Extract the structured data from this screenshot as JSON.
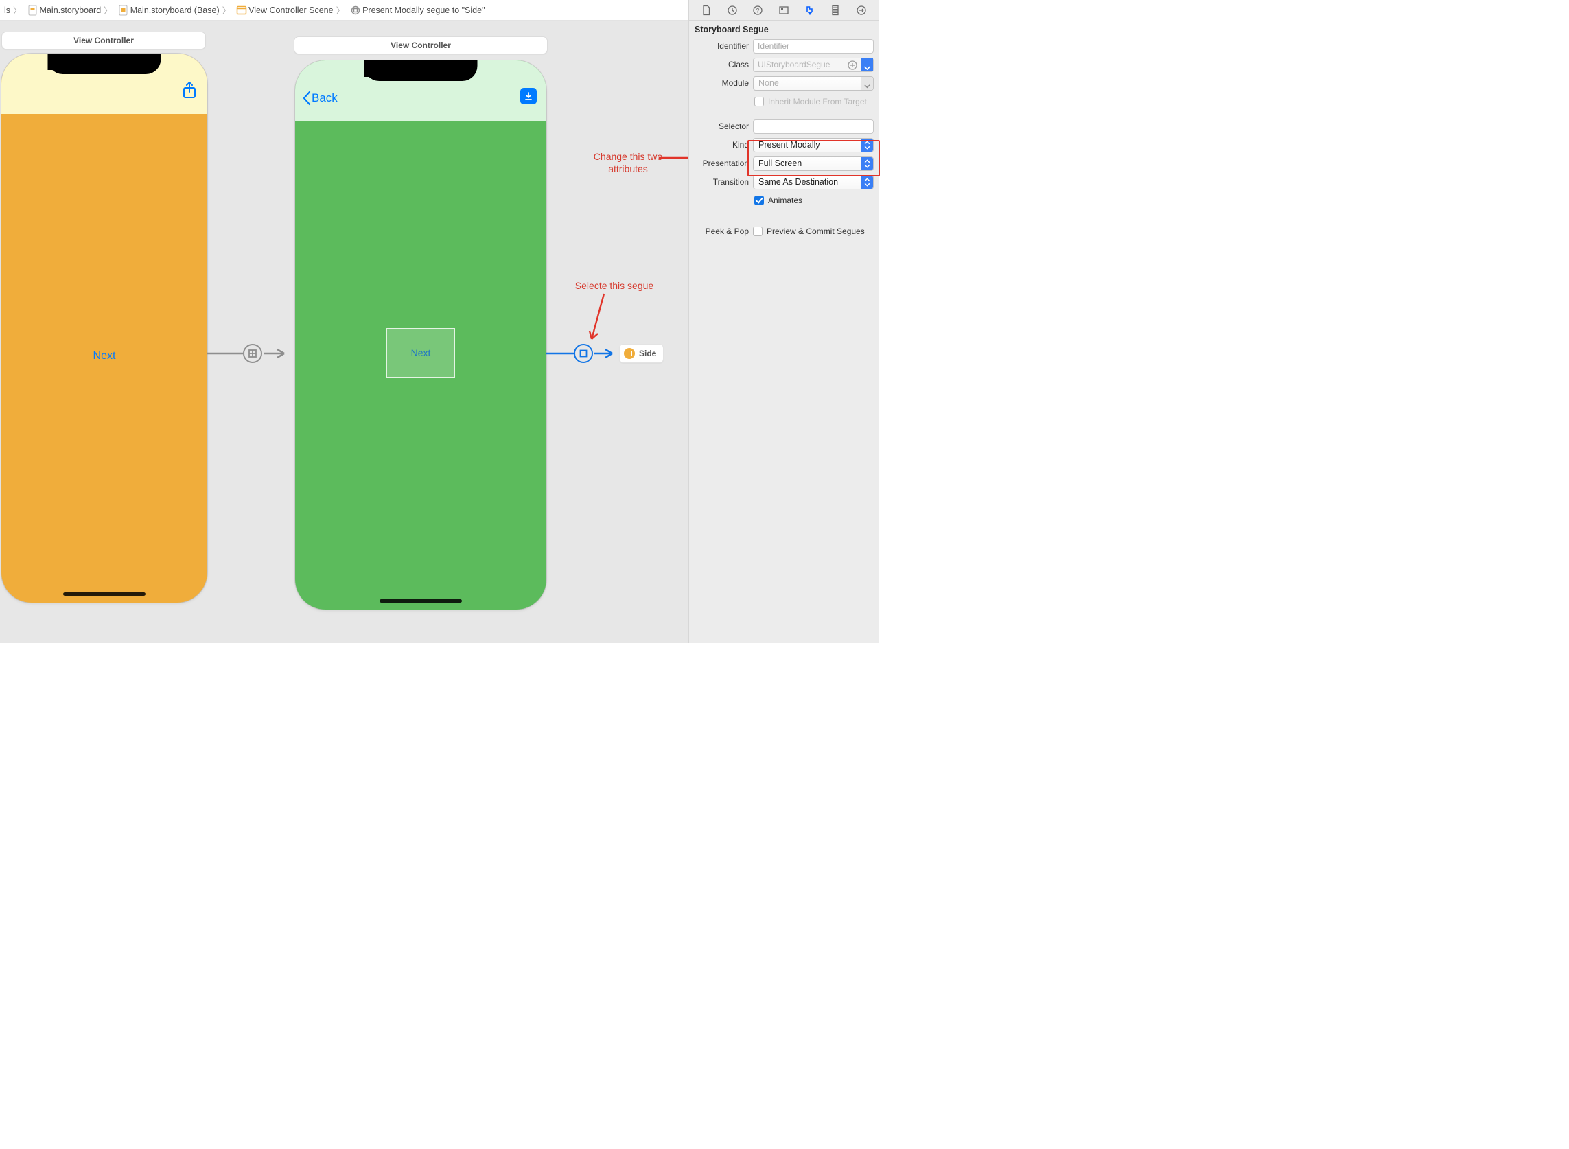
{
  "breadcrumbs": {
    "item0": "ls",
    "item1": "Main.storyboard",
    "item2": "Main.storyboard (Base)",
    "item3": "View Controller Scene",
    "item4": "Present Modally segue to \"Side\""
  },
  "canvas": {
    "vc1_title": "View Controller",
    "vc2_title": "View Controller",
    "vc1_button": "Next",
    "vc2_back": "Back",
    "vc2_button": "Next",
    "side_chip": "Side"
  },
  "annotations": {
    "select_segue": "Selecte this segue",
    "change_attrs_line1": "Change this two",
    "change_attrs_line2": "attributes"
  },
  "inspector": {
    "heading": "Storyboard Segue",
    "identifier": {
      "label": "Identifier",
      "placeholder": "Identifier",
      "value": ""
    },
    "klass": {
      "label": "Class",
      "placeholder": "UIStoryboardSegue",
      "value": ""
    },
    "module": {
      "label": "Module",
      "value": "None"
    },
    "inherit": {
      "label": "Inherit Module From Target",
      "checked": false
    },
    "selector": {
      "label": "Selector",
      "value": ""
    },
    "kind": {
      "label": "Kind",
      "value": "Present Modally"
    },
    "presentation": {
      "label": "Presentation",
      "value": "Full Screen"
    },
    "transition": {
      "label": "Transition",
      "value": "Same As Destination"
    },
    "animates": {
      "label": "Animates",
      "checked": true
    },
    "peeksection": {
      "label": "Peek & Pop",
      "preview_label": "Preview & Commit Segues",
      "checked": false
    }
  }
}
